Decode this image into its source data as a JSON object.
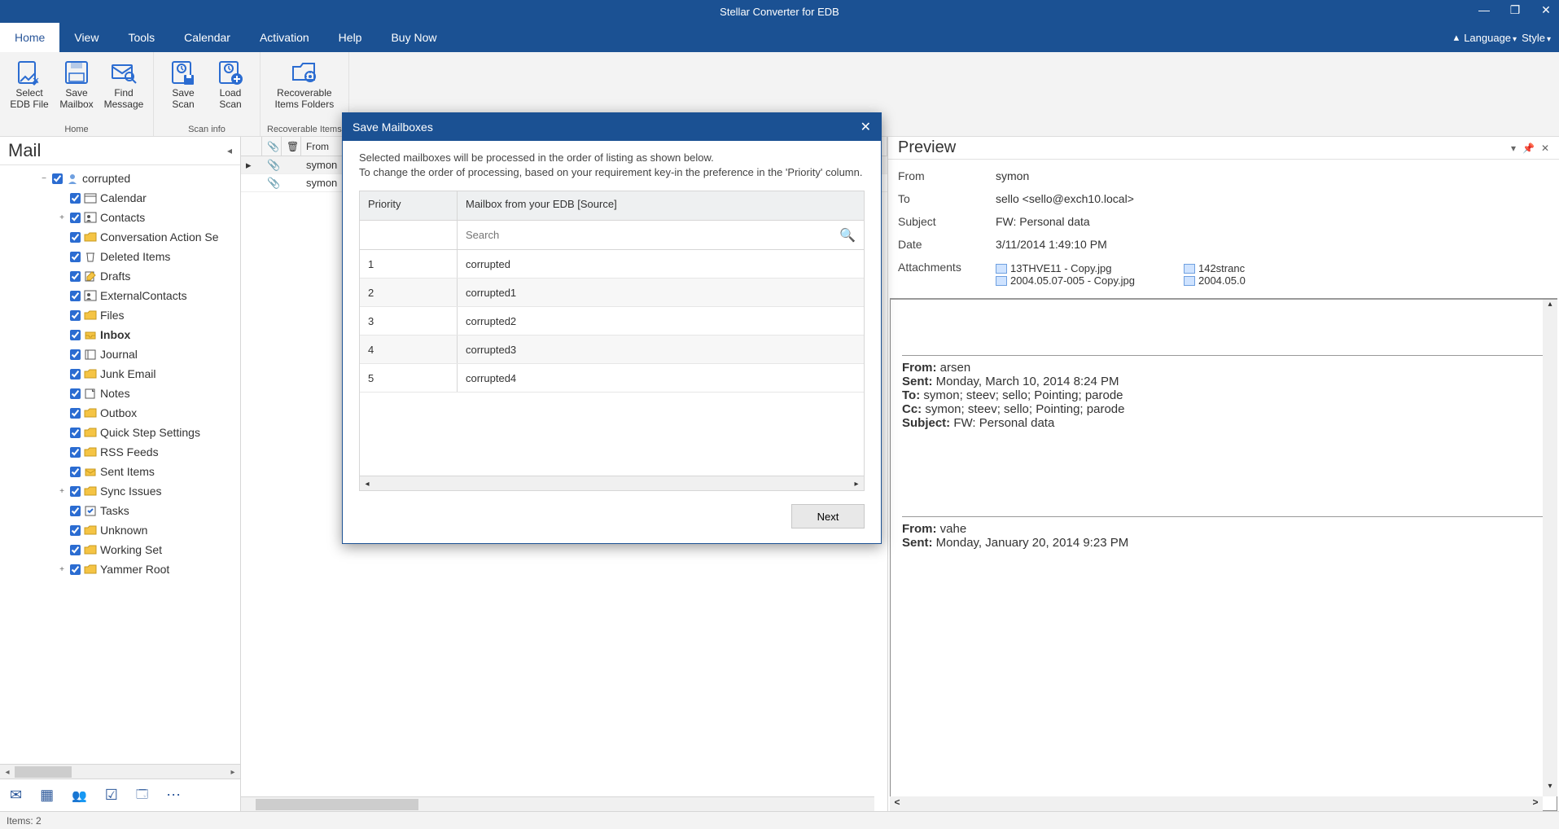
{
  "app_title": "Stellar Converter for EDB",
  "window_controls": {
    "min": "—",
    "max": "❐",
    "close": "✕"
  },
  "menu_tabs": [
    "Home",
    "View",
    "Tools",
    "Calendar",
    "Activation",
    "Help",
    "Buy Now"
  ],
  "menu_right": {
    "language": "Language",
    "style": "Style"
  },
  "ribbon": {
    "groups": [
      {
        "label": "Home",
        "buttons": [
          {
            "id": "select-edb",
            "line1": "Select",
            "line2": "EDB File"
          },
          {
            "id": "save-mailbox",
            "line1": "Save",
            "line2": "Mailbox"
          },
          {
            "id": "find-message",
            "line1": "Find",
            "line2": "Message"
          }
        ]
      },
      {
        "label": "Scan info",
        "buttons": [
          {
            "id": "save-scan",
            "line1": "Save",
            "line2": "Scan"
          },
          {
            "id": "load-scan",
            "line1": "Load",
            "line2": "Scan"
          }
        ]
      },
      {
        "label": "Recoverable Items",
        "buttons": [
          {
            "id": "recoverable-folders",
            "line1": "Recoverable",
            "line2": "Items Folders",
            "wide": true
          }
        ]
      }
    ]
  },
  "left_panel": {
    "header": "Mail",
    "root": "corrupted",
    "folders": [
      {
        "name": "Calendar",
        "icon": "calendar"
      },
      {
        "name": "Contacts",
        "icon": "contacts",
        "exp": "+"
      },
      {
        "name": "Conversation Action Se",
        "icon": "folder"
      },
      {
        "name": "Deleted Items",
        "icon": "trash"
      },
      {
        "name": "Drafts",
        "icon": "drafts"
      },
      {
        "name": "ExternalContacts",
        "icon": "contacts"
      },
      {
        "name": "Files",
        "icon": "folder"
      },
      {
        "name": "Inbox",
        "icon": "inbox",
        "bold": true
      },
      {
        "name": "Journal",
        "icon": "journal"
      },
      {
        "name": "Junk Email",
        "icon": "folder"
      },
      {
        "name": "Notes",
        "icon": "notes"
      },
      {
        "name": "Outbox",
        "icon": "folder"
      },
      {
        "name": "Quick Step Settings",
        "icon": "folder"
      },
      {
        "name": "RSS Feeds",
        "icon": "folder"
      },
      {
        "name": "Sent Items",
        "icon": "sent"
      },
      {
        "name": "Sync Issues",
        "icon": "folder",
        "exp": "+"
      },
      {
        "name": "Tasks",
        "icon": "tasks"
      },
      {
        "name": "Unknown",
        "icon": "folder"
      },
      {
        "name": "Working Set",
        "icon": "folder"
      },
      {
        "name": "Yammer Root",
        "icon": "folder",
        "exp": "+"
      }
    ]
  },
  "mid": {
    "col_from": "From",
    "rows": [
      "symon",
      "symon"
    ]
  },
  "preview": {
    "header": "Preview",
    "from_label": "From",
    "from_value": "symon",
    "to_label": "To",
    "to_value": "sello <sello@exch10.local>",
    "subject_label": "Subject",
    "subject_value": "FW: Personal data",
    "date_label": "Date",
    "date_value": "3/11/2014 1:49:10 PM",
    "attach_label": "Attachments",
    "attachments_col1": [
      "13THVE11 - Copy.jpg",
      "2004.05.07-005 - Copy.jpg"
    ],
    "attachments_col2": [
      "142stranc",
      "2004.05.0"
    ],
    "body": {
      "from1_label": "From:",
      "from1": " arsen",
      "sent1_label": "Sent:",
      "sent1": " Monday, March 10, 2014 8:24 PM",
      "to1_label": "To:",
      "to1": " symon; steev; sello; Pointing; parode",
      "cc1_label": "Cc:",
      "cc1": " symon; steev; sello; Pointing; parode",
      "subj1_label": "Subject:",
      "subj1": " FW: Personal data",
      "from2_label": "From:",
      "from2": " vahe",
      "sent2_label": "Sent:",
      "sent2": " Monday, January 20, 2014 9:23 PM"
    }
  },
  "dialog": {
    "title": "Save Mailboxes",
    "text1": "Selected mailboxes will be processed in the order of listing as shown below.",
    "text2": "To change the order of processing, based on your requirement key-in the preference in the 'Priority' column.",
    "col_priority": "Priority",
    "col_mailbox": "Mailbox from your EDB [Source]",
    "search_placeholder": "Search",
    "rows": [
      {
        "priority": "1",
        "name": "corrupted"
      },
      {
        "priority": "2",
        "name": "corrupted1"
      },
      {
        "priority": "3",
        "name": "corrupted2"
      },
      {
        "priority": "4",
        "name": "corrupted3"
      },
      {
        "priority": "5",
        "name": "corrupted4"
      }
    ],
    "next": "Next"
  },
  "status": "Items: 2"
}
